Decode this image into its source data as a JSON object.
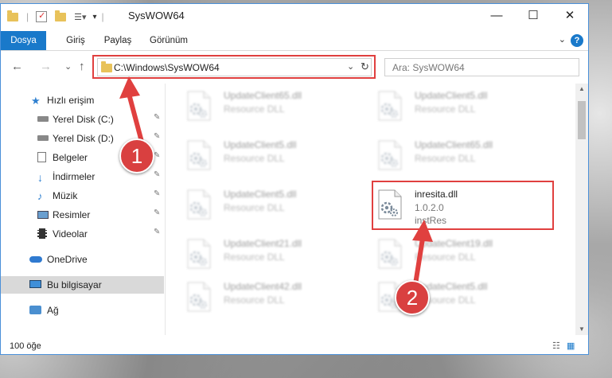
{
  "window": {
    "title": "SysWOW64",
    "minimize": "—",
    "maximize": "☐",
    "close": "✕"
  },
  "ribbon": {
    "tabs": [
      "Dosya",
      "Giriş",
      "Paylaş",
      "Görünüm"
    ],
    "active_tab": "Dosya",
    "help": "?"
  },
  "nav": {
    "back": "←",
    "forward": "→",
    "recent": "⌄",
    "up": "↑",
    "address": "C:\\Windows\\SysWOW64",
    "refresh": "↻",
    "search_placeholder": "Ara: SysWOW64"
  },
  "sidebar": {
    "items": [
      {
        "label": "Hızlı erişim",
        "icon": "star-icon"
      },
      {
        "label": "Yerel Disk (C:)",
        "icon": "drive-icon",
        "pinned": true
      },
      {
        "label": "Yerel Disk (D:)",
        "icon": "drive-icon",
        "pinned": true
      },
      {
        "label": "Belgeler",
        "icon": "documents-icon",
        "pinned": true
      },
      {
        "label": "İndirmeler",
        "icon": "download-icon",
        "pinned": true
      },
      {
        "label": "Müzik",
        "icon": "music-icon",
        "pinned": true
      },
      {
        "label": "Resimler",
        "icon": "pictures-icon",
        "pinned": true
      },
      {
        "label": "Videolar",
        "icon": "videos-icon",
        "pinned": true
      },
      {
        "label": "OneDrive",
        "icon": "cloud-icon"
      },
      {
        "label": "Bu bilgisayar",
        "icon": "computer-icon",
        "selected": true
      },
      {
        "label": "Ağ",
        "icon": "network-icon"
      }
    ],
    "pin_glyph": "📌"
  },
  "files": [
    {
      "name": "UpdateClient65.dll",
      "desc": "Resource DLL"
    },
    {
      "name": "UpdateClient5.dll",
      "desc": "Resource DLL"
    },
    {
      "name": "UpdateClient5.dll",
      "desc": "Resource DLL"
    },
    {
      "name": "UpdateClient65.dll",
      "desc": "Resource DLL"
    },
    {
      "name": "UpdateClient5.dll",
      "desc": "Resource DLL"
    },
    {
      "name": "inresita.dll",
      "version": "1.0.2.0",
      "desc": "instRes",
      "highlighted": true
    },
    {
      "name": "UpdateClient21.dll",
      "desc": "Resource DLL"
    },
    {
      "name": "UpdateClient19.dll",
      "desc": "Resource DLL"
    },
    {
      "name": "UpdateClient42.dll",
      "desc": "Resource DLL"
    },
    {
      "name": "UpdateClient5.dll",
      "desc": "Resource DLL"
    }
  ],
  "status": {
    "count": "100 öğe"
  },
  "annotations": {
    "step1": "1",
    "step2": "2",
    "accent": "#e0403f"
  }
}
